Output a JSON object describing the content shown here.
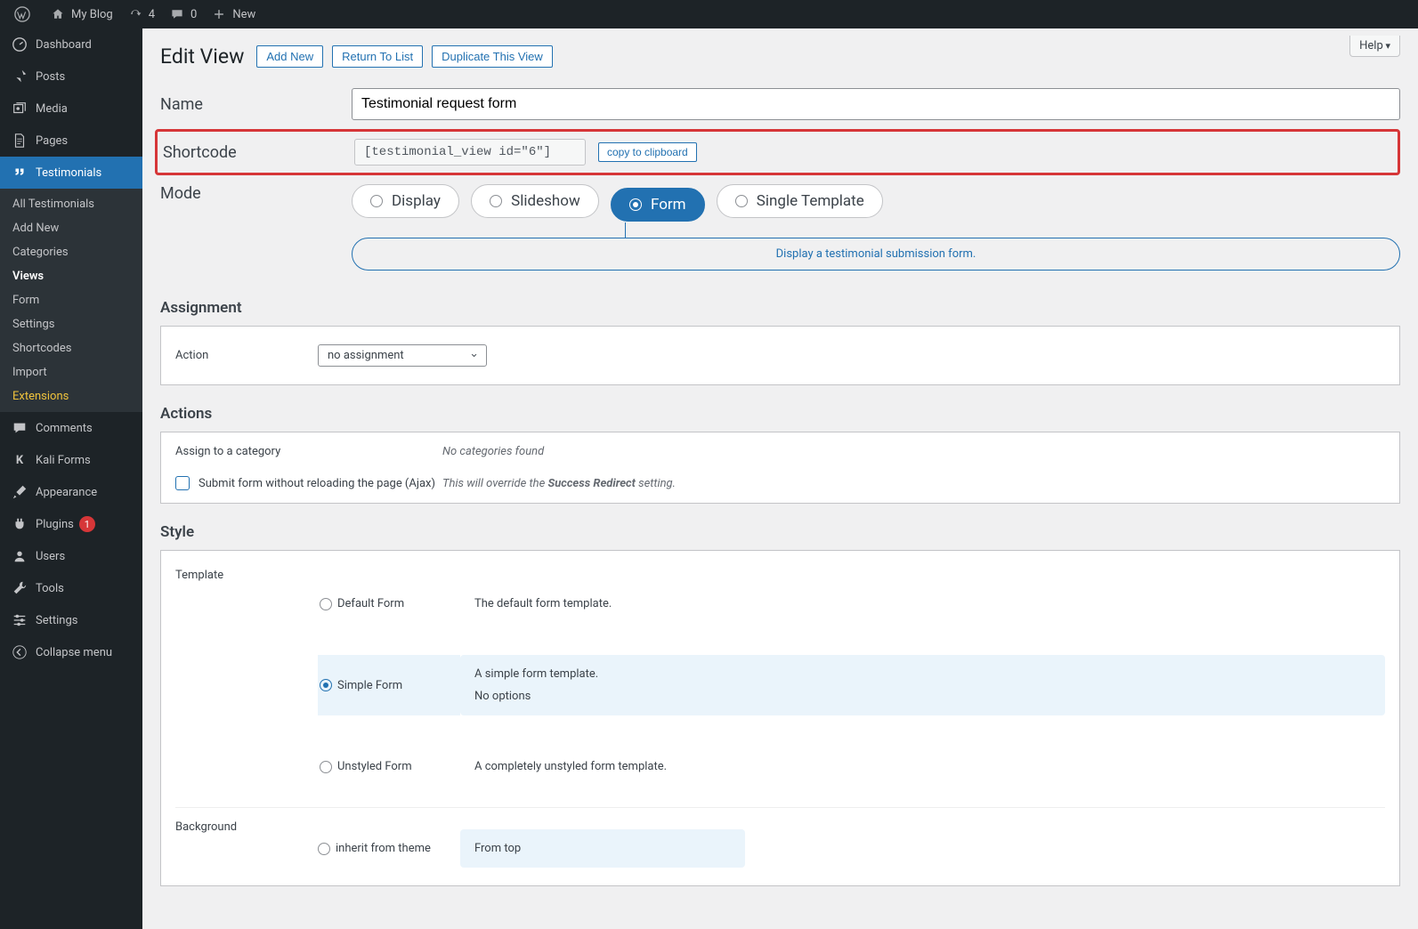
{
  "adminbar": {
    "site": "My Blog",
    "updates": "4",
    "comments": "0",
    "new": "New"
  },
  "sidebar": {
    "dashboard": "Dashboard",
    "posts": "Posts",
    "media": "Media",
    "pages": "Pages",
    "testimonials": "Testimonials",
    "sub": {
      "all": "All Testimonials",
      "add": "Add New",
      "categories": "Categories",
      "views": "Views",
      "form": "Form",
      "settings": "Settings",
      "shortcodes": "Shortcodes",
      "import": "Import",
      "extensions": "Extensions"
    },
    "comments": "Comments",
    "kaliforms": "Kali Forms",
    "appearance": "Appearance",
    "plugins": "Plugins",
    "plugins_badge": "1",
    "users": "Users",
    "tools": "Tools",
    "settings": "Settings",
    "collapse": "Collapse menu"
  },
  "content": {
    "help": "Help",
    "title": "Edit View",
    "buttons": {
      "add": "Add New",
      "return": "Return To List",
      "duplicate": "Duplicate This View"
    },
    "name_label": "Name",
    "name_value": "Testimonial request form",
    "shortcode_label": "Shortcode",
    "shortcode_value": "[testimonial_view id=\"6\"]",
    "copy": "copy to clipboard",
    "mode_label": "Mode",
    "modes": {
      "display": "Display",
      "slideshow": "Slideshow",
      "form": "Form",
      "single": "Single Template"
    },
    "mode_desc": "Display a testimonial submission form.",
    "assignment": {
      "heading": "Assignment",
      "action_label": "Action",
      "action_value": "no assignment"
    },
    "actions": {
      "heading": "Actions",
      "assign_label": "Assign to a category",
      "assign_value": "No categories found",
      "ajax_label": "Submit form without reloading the page (Ajax)",
      "ajax_note_1": "This will override the ",
      "ajax_note_2": "Success Redirect",
      "ajax_note_3": " setting."
    },
    "style": {
      "heading": "Style",
      "template_label": "Template",
      "options": {
        "default": {
          "name": "Default Form",
          "desc": "The default form template."
        },
        "simple": {
          "name": "Simple Form",
          "desc1": "A simple form template.",
          "desc2": "No options"
        },
        "unstyled": {
          "name": "Unstyled Form",
          "desc": "A completely unstyled form template."
        }
      },
      "background_label": "Background",
      "bg_inherit": "inherit from theme",
      "bg_fromtop": "From top"
    }
  }
}
